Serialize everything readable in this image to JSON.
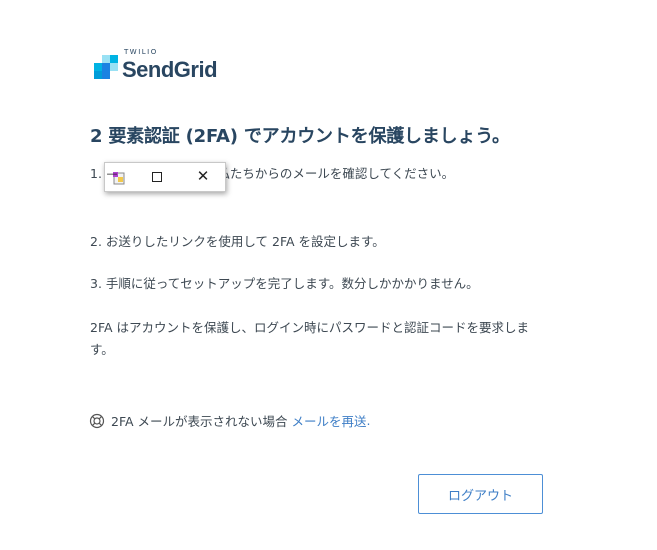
{
  "logo": {
    "brand_small": "TWILIO",
    "brand_name": "SendGrid",
    "colors": [
      "#99e1f4",
      "#1a82e2",
      "#00b3e3",
      "#009dd9",
      "#263f56"
    ]
  },
  "heading": "2 要素認証 (2FA) でアカウントを保護しましょう。",
  "steps": {
    "step1": "1. ...の受信トレイで、私たちからのメールを確認してください。",
    "step2": "2. お送りしたリンクを使用して 2FA を設定します。",
    "step3": "3. 手順に従ってセットアップを完了します。数分しかかかりません。"
  },
  "info": "2FA はアカウントを保護し、ログイン時にパスワードと認証コードを要求します。",
  "resend": {
    "icon": "lifebuoy-icon",
    "text": "2FA メールが表示されない場合",
    "link": "メールを再送",
    "period": "."
  },
  "logout_label": "ログアウト",
  "mini_window": {
    "icon": "app-icon",
    "minimize": "—",
    "close": "✕"
  }
}
